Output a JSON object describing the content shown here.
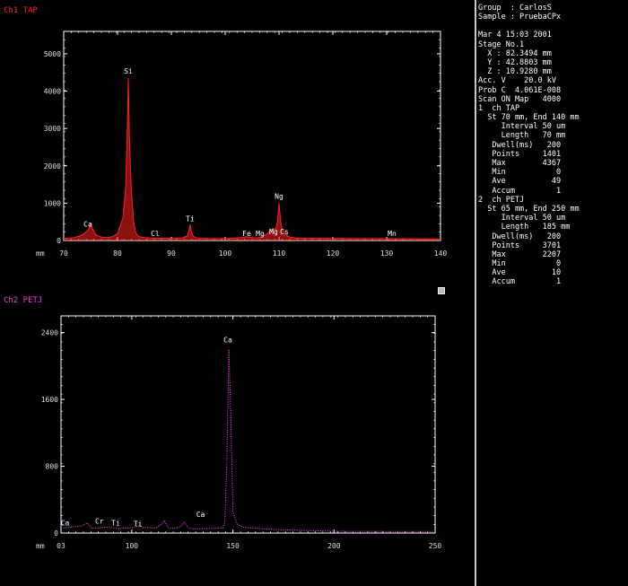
{
  "colors": {
    "background": "#000000",
    "frame": "#ffffff",
    "ch1": "#ff2020",
    "ch2": "#e040e0",
    "text": "#ffffff",
    "divider": "#c8c8c8"
  },
  "chart_data": [
    {
      "type": "line",
      "title": "Ch1 TAP",
      "xlabel": "mm",
      "xlim": [
        70,
        140
      ],
      "ylim": [
        0,
        5600
      ],
      "x_ticks": [
        70,
        80,
        90,
        100,
        110,
        120,
        130,
        140
      ],
      "x_tick_labels": [
        "70",
        "80",
        "90",
        "100",
        "110",
        "120",
        "130",
        "140"
      ],
      "y_ticks": [
        0,
        1000,
        2000,
        3000,
        4000,
        5000
      ],
      "y_tick_labels": [
        "0",
        "1000",
        "2000",
        "3000",
        "4000",
        "5000"
      ],
      "series": [
        {
          "x": [
            70,
            72,
            73.5,
            74.5,
            75,
            75.4,
            76,
            77,
            78,
            79,
            80,
            81,
            81.5,
            81.8,
            82,
            82.2,
            82.4,
            82.6,
            82.8,
            83,
            83.3,
            83.6,
            84,
            85,
            86,
            88,
            90,
            92,
            93,
            93.3,
            93.5,
            93.7,
            94,
            94.5,
            95,
            97,
            99,
            101,
            103,
            104,
            105,
            106,
            107,
            108,
            108.5,
            109,
            109.4,
            109.7,
            110,
            110.2,
            110.4,
            110.6,
            110.8,
            111,
            111.3,
            111.6,
            112,
            113,
            115,
            120,
            125,
            130,
            135,
            140
          ],
          "y": [
            50,
            80,
            150,
            280,
            420,
            300,
            150,
            90,
            80,
            100,
            180,
            600,
            1400,
            2900,
            4350,
            2800,
            1900,
            1300,
            900,
            500,
            250,
            150,
            100,
            80,
            70,
            60,
            60,
            70,
            120,
            300,
            420,
            250,
            120,
            80,
            60,
            50,
            50,
            60,
            80,
            100,
            80,
            70,
            110,
            200,
            280,
            320,
            300,
            500,
            1000,
            680,
            420,
            300,
            250,
            220,
            170,
            120,
            90,
            70,
            60,
            55,
            50,
            50,
            45,
            40
          ]
        }
      ],
      "annotations": [
        {
          "label": "Ca",
          "x": 74.5,
          "y": 300
        },
        {
          "label": "Si",
          "x": 82,
          "y": 4400
        },
        {
          "label": "Ti",
          "x": 93.5,
          "y": 450
        },
        {
          "label": "Cl",
          "x": 87,
          "y": 50
        },
        {
          "label": "Fe",
          "x": 104,
          "y": 50
        },
        {
          "label": "Mg",
          "x": 106.5,
          "y": 50
        },
        {
          "label": "Mg",
          "x": 109,
          "y": 100
        },
        {
          "label": "Cs",
          "x": 111,
          "y": 100
        },
        {
          "label": "Ng",
          "x": 110,
          "y": 1050
        },
        {
          "label": "Mn",
          "x": 131,
          "y": 50
        }
      ]
    },
    {
      "type": "line",
      "title": "Ch2 PETJ",
      "xlabel": "mm",
      "xlim": [
        65,
        250
      ],
      "ylim": [
        0,
        2600
      ],
      "x_ticks": [
        65,
        100,
        150,
        200,
        250
      ],
      "x_tick_labels": [
        "03",
        "100",
        "150",
        "200",
        "250"
      ],
      "y_ticks": [
        0,
        800,
        1600,
        2400
      ],
      "y_tick_labels": [
        "0",
        "800",
        "1600",
        "2400"
      ],
      "series": [
        {
          "x": [
            65,
            70,
            72,
            75,
            78,
            80,
            82,
            84,
            86,
            88,
            90,
            92,
            94,
            96,
            98,
            100,
            102,
            104,
            106,
            108,
            110,
            112,
            114,
            116,
            118,
            120,
            122,
            124,
            126,
            128,
            130,
            135,
            140,
            145,
            146,
            147,
            148,
            149,
            150,
            152,
            155,
            160,
            165,
            170,
            175,
            180,
            185,
            190,
            195,
            200,
            210,
            220,
            230,
            240,
            250
          ],
          "y": [
            60,
            70,
            80,
            80,
            120,
            60,
            55,
            60,
            70,
            70,
            65,
            60,
            55,
            60,
            60,
            60,
            80,
            90,
            60,
            70,
            60,
            60,
            90,
            150,
            60,
            55,
            60,
            75,
            130,
            60,
            50,
            50,
            55,
            60,
            130,
            820,
            2200,
            1400,
            260,
            110,
            70,
            60,
            50,
            45,
            40,
            35,
            30,
            28,
            25,
            22,
            20,
            20,
            18,
            18,
            18
          ]
        }
      ],
      "annotations": [
        {
          "label": "Ca",
          "x": 147.5,
          "y": 2250
        },
        {
          "label": "Ca",
          "x": 134,
          "y": 160
        },
        {
          "label": "Cr",
          "x": 84,
          "y": 80
        },
        {
          "label": "Ti",
          "x": 92,
          "y": 60
        },
        {
          "label": "Ti",
          "x": 103,
          "y": 50
        },
        {
          "label": "Ca",
          "x": 67,
          "y": 60
        }
      ]
    }
  ],
  "side_panel": {
    "lines": [
      "Group  : CarlosS",
      "Sample : PruebaCPx",
      "",
      "Mar 4 15:03 2001",
      "Stage No.1",
      "  X : 82.3494 mm",
      "  Y : 42.8803 mm",
      "  Z : 10.9280 mm",
      "Acc. V    20.0 kV",
      "Prob C  4.061E-008",
      "Scan ON Map   4000",
      "1  ch TAP",
      "  St 70 mm, End 140 mm",
      "     Interval 50 um",
      "     Length   70 mm",
      "   Dwell(ms)   200",
      "   Points     1401",
      "   Max        4367",
      "   Min           0",
      "   Ave          49",
      "   Accum         1",
      "2  ch PETJ",
      "  St 65 mm, End 250 mm",
      "     Interval 50 um",
      "     Length   185 mm",
      "   Dwell(ms)   200",
      "   Points     3701",
      "   Max        2207",
      "   Min           0",
      "   Ave          10",
      "   Accum         1"
    ]
  }
}
